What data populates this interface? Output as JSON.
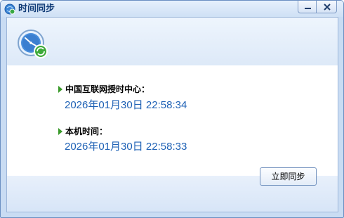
{
  "window": {
    "title": "时间同步",
    "app_icon": "globe-sync-icon",
    "minimize_icon": "minimize-icon",
    "close_icon": "close-icon"
  },
  "header": {
    "icon": "clock-sync-icon"
  },
  "internet_time": {
    "label": "中国互联网授时中心：",
    "value": "2026年01月30日 22:58:34"
  },
  "local_time": {
    "label": "本机时间：",
    "value": "2026年01月30日 22:58:33"
  },
  "footer": {
    "sync_button_label": "立即同步"
  },
  "colors": {
    "accent_text": "#1e61b5",
    "arrow": "#3a9a2a",
    "frame": "#c9dcf3"
  }
}
